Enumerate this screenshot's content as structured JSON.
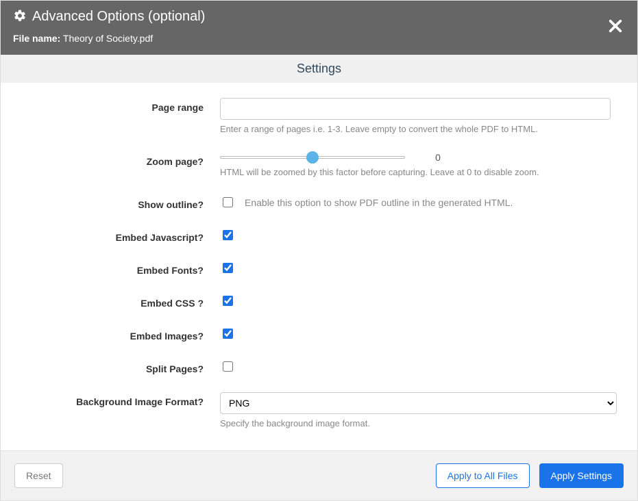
{
  "header": {
    "title": "Advanced Options (optional)",
    "file_name_label": "File name:",
    "file_name_value": "Theory of Society.pdf"
  },
  "settings_title": "Settings",
  "fields": {
    "page_range": {
      "label": "Page range",
      "value": "",
      "help": "Enter a range of pages i.e. 1-3. Leave empty to convert the whole PDF to HTML."
    },
    "zoom": {
      "label": "Zoom page?",
      "value": 0,
      "slider_percent": 50,
      "help": "HTML will be zoomed by this factor before capturing. Leave at 0 to disable zoom."
    },
    "show_outline": {
      "label": "Show outline?",
      "checked": false,
      "checkbox_label": "Enable this option to show PDF outline in the generated HTML."
    },
    "embed_js": {
      "label": "Embed Javascript?",
      "checked": true
    },
    "embed_fonts": {
      "label": "Embed Fonts?",
      "checked": true
    },
    "embed_css": {
      "label": "Embed CSS ?",
      "checked": true
    },
    "embed_images": {
      "label": "Embed Images?",
      "checked": true
    },
    "split_pages": {
      "label": "Split Pages?",
      "checked": false
    },
    "bg_format": {
      "label": "Background Image Format?",
      "selected": "PNG",
      "help": "Specify the background image format."
    }
  },
  "footer": {
    "reset": "Reset",
    "apply_all": "Apply to All Files",
    "apply": "Apply Settings"
  }
}
